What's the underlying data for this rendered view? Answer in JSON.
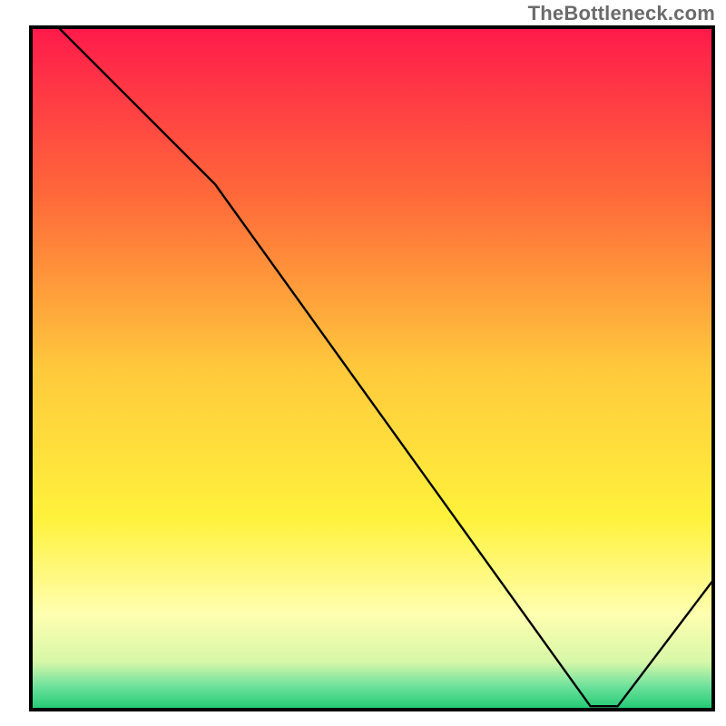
{
  "watermark": "TheBottleneck.com",
  "chart_data": {
    "type": "line",
    "title": "",
    "xlabel": "",
    "ylabel": "",
    "xlim": [
      0,
      100
    ],
    "ylim": [
      0,
      100
    ],
    "grid": false,
    "legend": false,
    "background_gradient": {
      "stops": [
        {
          "offset": 0.0,
          "color": "#ff1a4b"
        },
        {
          "offset": 0.25,
          "color": "#ff6a3a"
        },
        {
          "offset": 0.5,
          "color": "#ffc93c"
        },
        {
          "offset": 0.72,
          "color": "#fff23c"
        },
        {
          "offset": 0.86,
          "color": "#ffffb0"
        },
        {
          "offset": 0.93,
          "color": "#d7f7a8"
        },
        {
          "offset": 0.965,
          "color": "#6fe29d"
        },
        {
          "offset": 1.0,
          "color": "#1ec971"
        }
      ]
    },
    "series": [
      {
        "name": "curve",
        "x": [
          4.0,
          27.0,
          82.0,
          86.0,
          100.0
        ],
        "y": [
          100.0,
          77.0,
          0.5,
          0.5,
          19.0
        ]
      }
    ],
    "annotations": [
      {
        "text": "",
        "x": 83,
        "y": 1.5
      }
    ],
    "frame": {
      "inner_left": 34,
      "inner_top": 30,
      "inner_right": 786,
      "inner_bottom": 782,
      "stroke": "#000000",
      "stroke_width": 4
    }
  }
}
